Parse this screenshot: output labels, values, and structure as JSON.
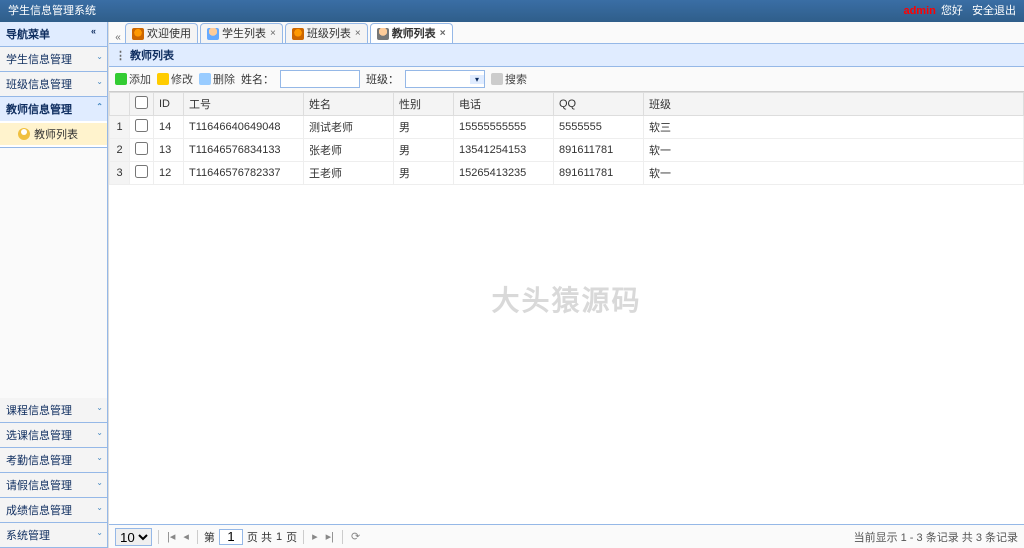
{
  "app": {
    "title": "学生信息管理系统"
  },
  "header_right": {
    "user": "admin",
    "greet": "您好",
    "exit": "安全退出"
  },
  "sidebar": {
    "title": "导航菜单",
    "top_items": [
      {
        "label": "学生信息管理",
        "open": false
      },
      {
        "label": "班级信息管理",
        "open": false
      },
      {
        "label": "教师信息管理",
        "open": true,
        "children": [
          {
            "label": "教师列表"
          }
        ]
      }
    ],
    "bottom_items": [
      {
        "label": "课程信息管理"
      },
      {
        "label": "选课信息管理"
      },
      {
        "label": "考勤信息管理"
      },
      {
        "label": "请假信息管理"
      },
      {
        "label": "成绩信息管理"
      },
      {
        "label": "系统管理"
      }
    ]
  },
  "tabs": [
    {
      "label": "欢迎使用",
      "icon": "home",
      "closable": false,
      "active": false
    },
    {
      "label": "学生列表",
      "icon": "user",
      "closable": true,
      "active": false
    },
    {
      "label": "班级列表",
      "icon": "home",
      "closable": true,
      "active": false
    },
    {
      "label": "教师列表",
      "icon": "teacher",
      "closable": true,
      "active": true
    }
  ],
  "panel": {
    "title": "教师列表"
  },
  "toolbar": {
    "add": "添加",
    "edit": "修改",
    "del": "删除",
    "name_label": "姓名：",
    "class_label": "班级：",
    "search": "搜索",
    "name_value": "",
    "class_value": ""
  },
  "grid": {
    "columns": [
      "",
      "ID",
      "工号",
      "姓名",
      "性别",
      "电话",
      "QQ",
      "班级"
    ],
    "rows": [
      {
        "n": "1",
        "id": "14",
        "no": "T11646640649048",
        "name": "测试老师",
        "sex": "男",
        "tel": "15555555555",
        "qq": "5555555",
        "cls": "软三"
      },
      {
        "n": "2",
        "id": "13",
        "no": "T11646576834133",
        "name": "张老师",
        "sex": "男",
        "tel": "13541254153",
        "qq": "891611781",
        "cls": "软一"
      },
      {
        "n": "3",
        "id": "12",
        "no": "T11646576782337",
        "name": "王老师",
        "sex": "男",
        "tel": "15265413235",
        "qq": "891611781",
        "cls": "软一"
      }
    ]
  },
  "watermark": "大头猿源码",
  "pager": {
    "size_value": "10",
    "page_prefix": "第",
    "page_value": "1",
    "page_mid": "页 共",
    "page_total": "1",
    "page_suffix": "页",
    "info": "当前显示 1 - 3 条记录 共 3 条记录"
  }
}
